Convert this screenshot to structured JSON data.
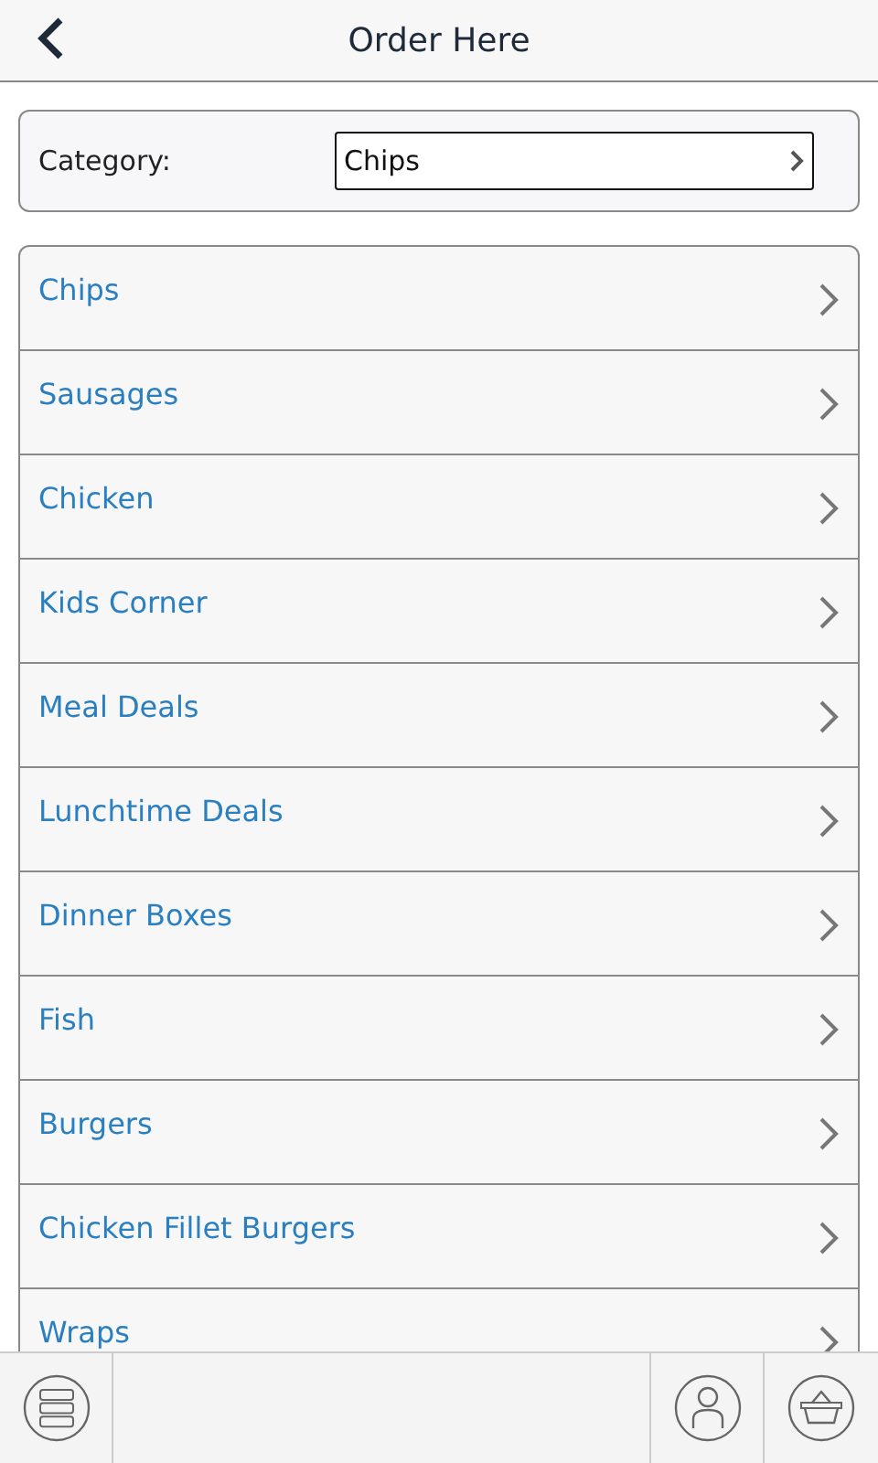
{
  "header": {
    "title": "Order Here"
  },
  "category": {
    "label": "Category:",
    "value": "Chips"
  },
  "menu_items": [
    {
      "label": "Chips"
    },
    {
      "label": "Sausages"
    },
    {
      "label": "Chicken"
    },
    {
      "label": "Kids Corner"
    },
    {
      "label": "Meal Deals"
    },
    {
      "label": "Lunchtime Deals"
    },
    {
      "label": "Dinner Boxes"
    },
    {
      "label": "Fish"
    },
    {
      "label": "Burgers"
    },
    {
      "label": "Chicken Fillet Burgers"
    },
    {
      "label": "Wraps"
    }
  ]
}
